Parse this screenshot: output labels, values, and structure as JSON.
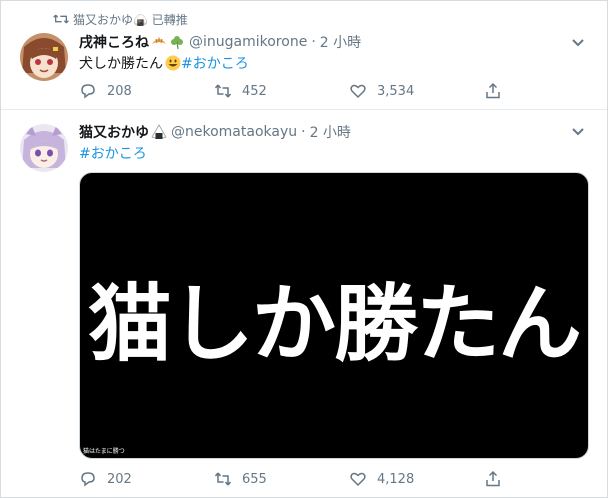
{
  "tweet1": {
    "retweeted_by": "猫又おかゆ🍙 已轉推",
    "display_name": "戌神ころね",
    "name_emojis": [
      "croissant-emoji",
      "clover-emoji"
    ],
    "handle": "@inugamikorone",
    "separator": "·",
    "time": "2 小時",
    "text": "犬しか勝たん",
    "text_emoji": "grinning-face-emoji",
    "hashtag": "#おかころ",
    "replies": "208",
    "retweets": "452",
    "likes": "3,534"
  },
  "tweet2": {
    "display_name": "猫又おかゆ",
    "name_emoji": "rice-ball-emoji",
    "handle": "@nekomataokayu",
    "separator": "·",
    "time": "2 小時",
    "hashtag": "#おかころ",
    "media_title": "猫しか勝たん",
    "media_caption": "猫はたまに勝つ",
    "replies": "202",
    "retweets": "655",
    "likes": "4,128"
  },
  "colors": {
    "accent": "#1b95e0",
    "muted": "#657786",
    "text": "#14171a",
    "border": "#e6ecf0"
  }
}
